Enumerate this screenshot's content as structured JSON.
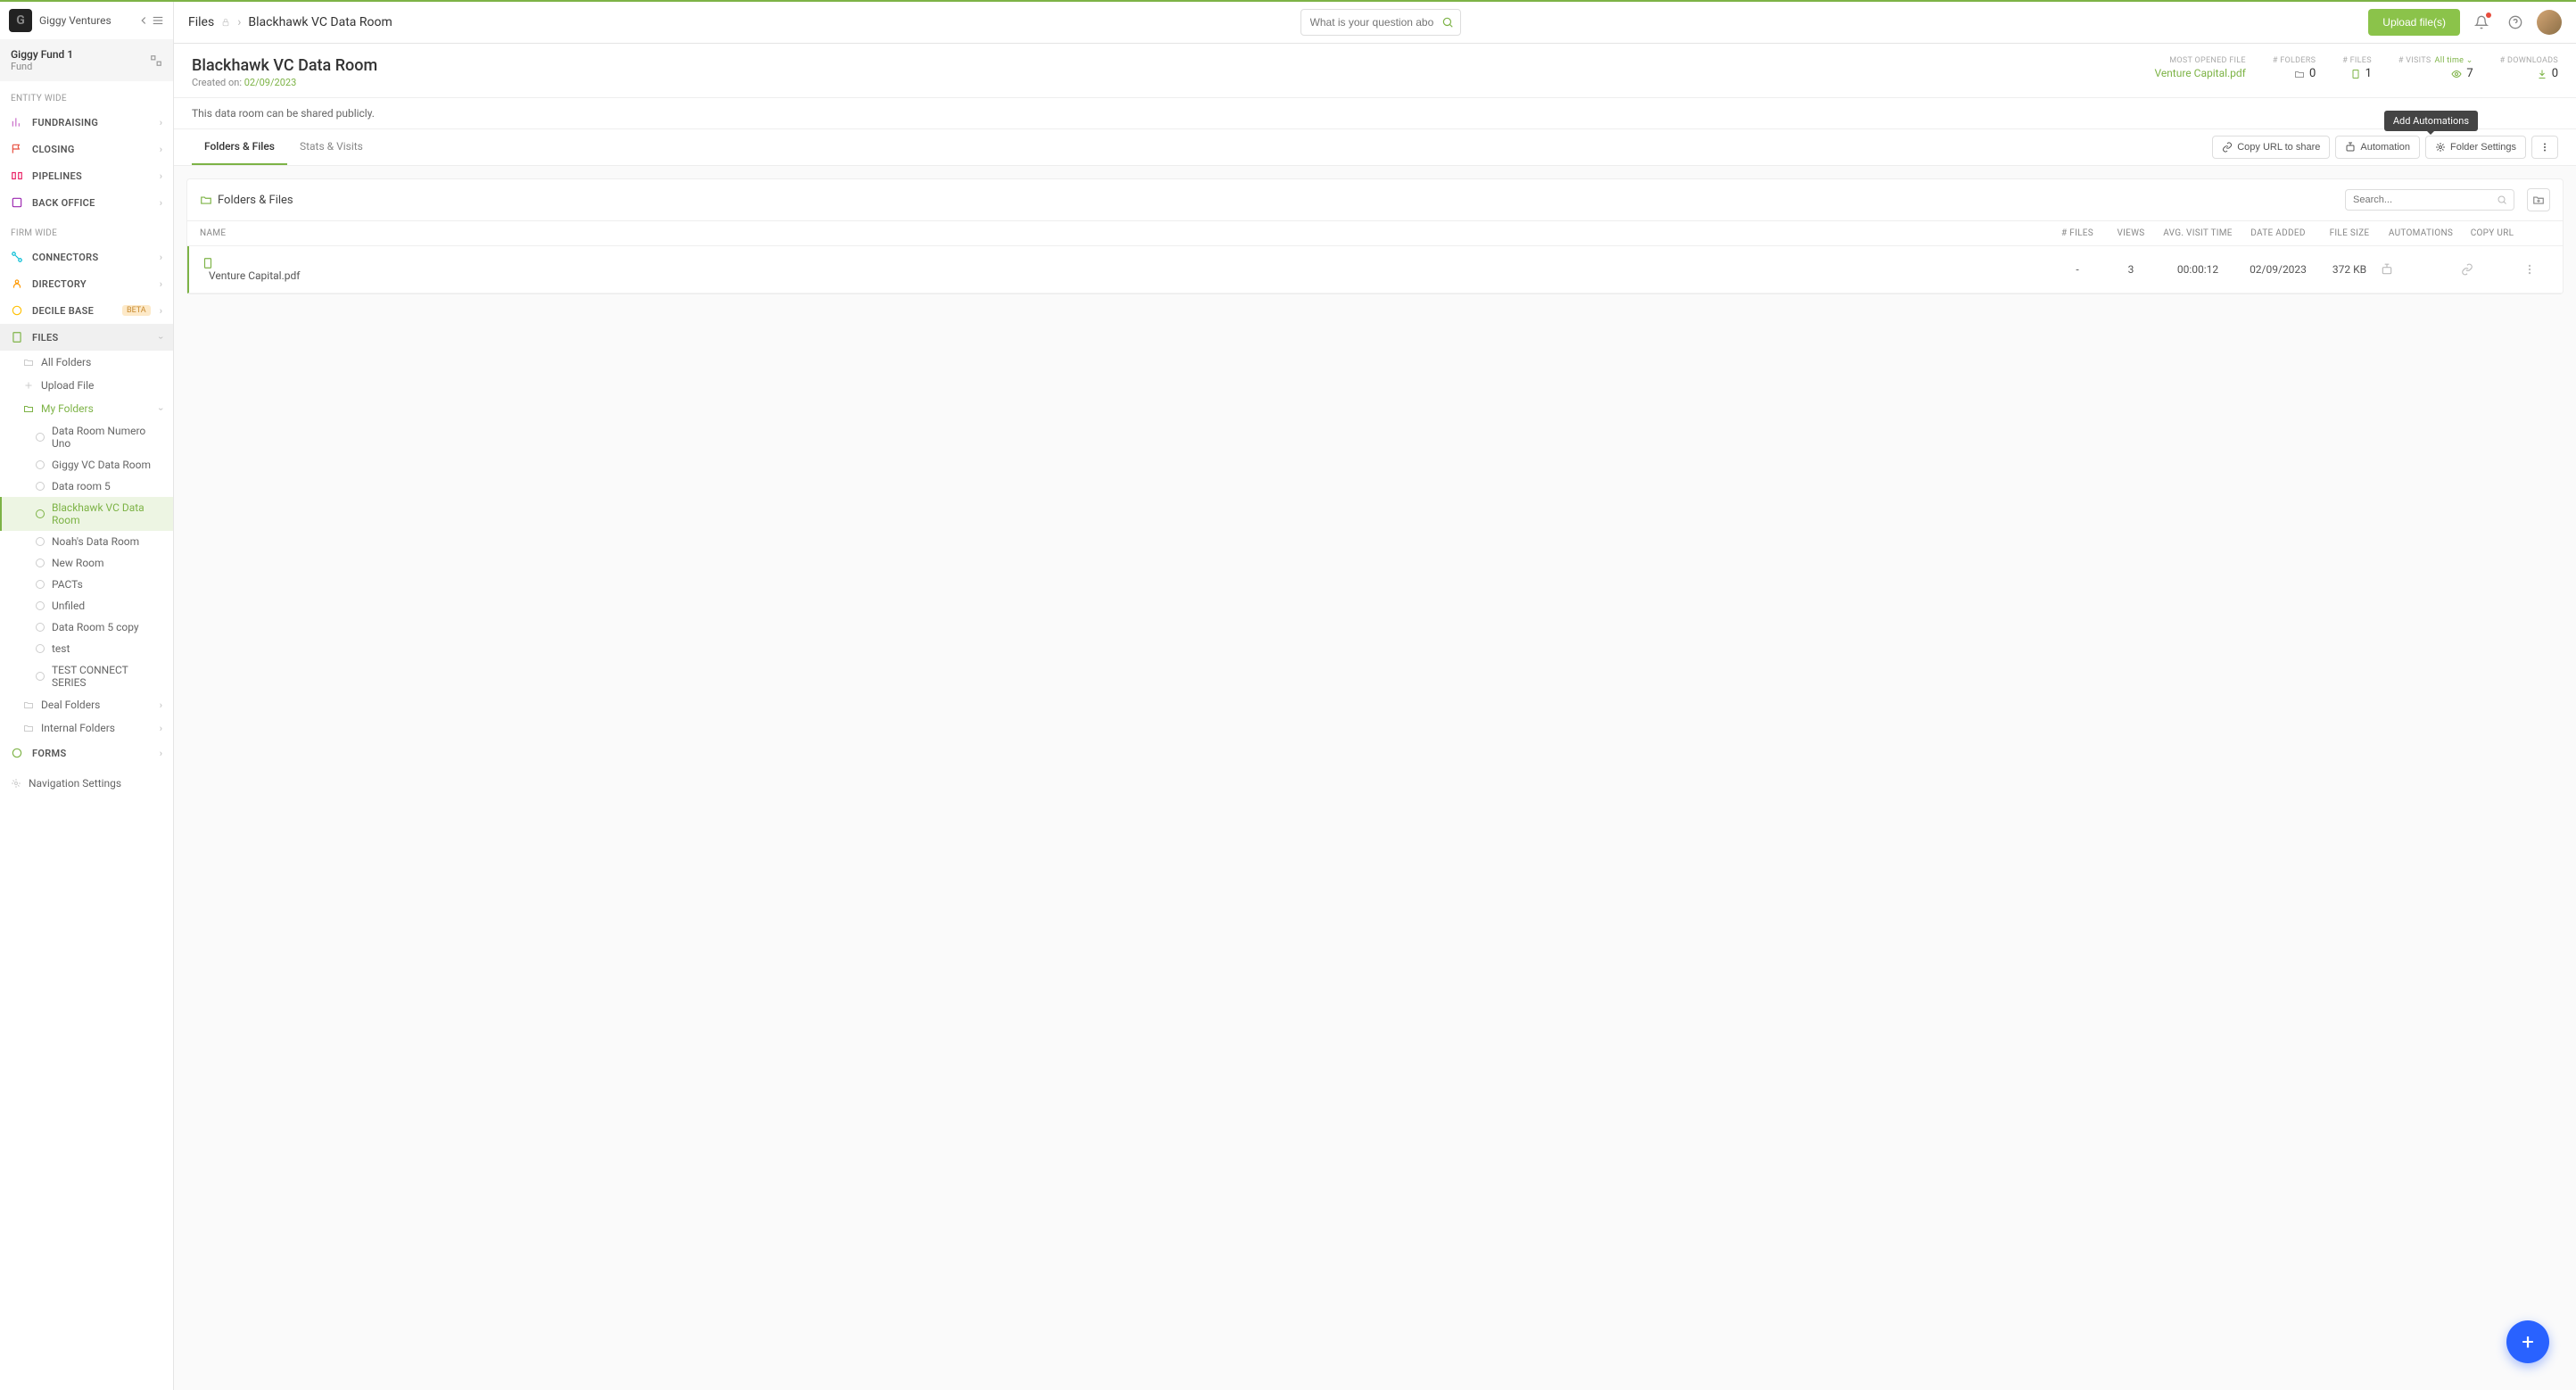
{
  "brand": {
    "name": "Giggy Ventures",
    "logo_letter": "G"
  },
  "fund": {
    "name": "Giggy Fund 1",
    "type": "Fund"
  },
  "sections": {
    "entity_wide": "ENTITY WIDE",
    "firm_wide": "FIRM WIDE"
  },
  "nav": {
    "fundraising": "FUNDRAISING",
    "closing": "CLOSING",
    "pipelines": "PIPELINES",
    "back_office": "BACK OFFICE",
    "connectors": "CONNECTORS",
    "directory": "DIRECTORY",
    "decile_base": "DECILE BASE",
    "decile_badge": "BETA",
    "files": "FILES",
    "forms": "FORMS",
    "nav_settings": "Navigation Settings"
  },
  "files_nav": {
    "all_folders": "All Folders",
    "upload_file": "Upload File",
    "my_folders": "My Folders",
    "deal_folders": "Deal Folders",
    "internal_folders": "Internal Folders"
  },
  "folders": [
    "Data Room Numero Uno",
    "Giggy VC Data Room",
    "Data room 5",
    "Blackhawk VC Data Room",
    "Noah's Data Room",
    "New Room",
    "PACTs",
    "Unfiled",
    "Data Room 5 copy",
    "test",
    "TEST CONNECT SERIES"
  ],
  "selected_folder_index": 3,
  "breadcrumb": {
    "root": "Files",
    "current": "Blackhawk VC Data Room"
  },
  "search": {
    "placeholder": "What is your question about VC?"
  },
  "topbar": {
    "upload": "Upload file(s)"
  },
  "header": {
    "title": "Blackhawk VC Data Room",
    "created_label": "Created on:",
    "created_date": "02/09/2023"
  },
  "stats": {
    "most_opened_label": "MOST OPENED FILE",
    "most_opened_value": "Venture Capital.pdf",
    "folders_label": "# FOLDERS",
    "folders_value": "0",
    "files_label": "# FILES",
    "files_value": "1",
    "visits_label": "# VISITS",
    "visits_period": "All time",
    "visits_value": "7",
    "downloads_label": "# DOWNLOADS",
    "downloads_value": "0"
  },
  "share_note": "This data room can be shared publicly.",
  "tabs": {
    "folders_files": "Folders & Files",
    "stats_visits": "Stats & Visits"
  },
  "actions": {
    "copy_url": "Copy URL to share",
    "automation": "Automation",
    "folder_settings": "Folder Settings",
    "tooltip": "Add Automations"
  },
  "panel": {
    "title": "Folders & Files",
    "search_placeholder": "Search..."
  },
  "table": {
    "headers": {
      "name": "NAME",
      "files": "# FILES",
      "views": "VIEWS",
      "avg": "AVG. VISIT TIME",
      "date": "DATE ADDED",
      "size": "FILE SIZE",
      "auto": "AUTOMATIONS",
      "copy": "COPY URL"
    },
    "rows": [
      {
        "name": "Venture Capital.pdf",
        "files": "-",
        "views": "3",
        "avg": "00:00:12",
        "date": "02/09/2023",
        "size": "372 KB"
      }
    ]
  }
}
